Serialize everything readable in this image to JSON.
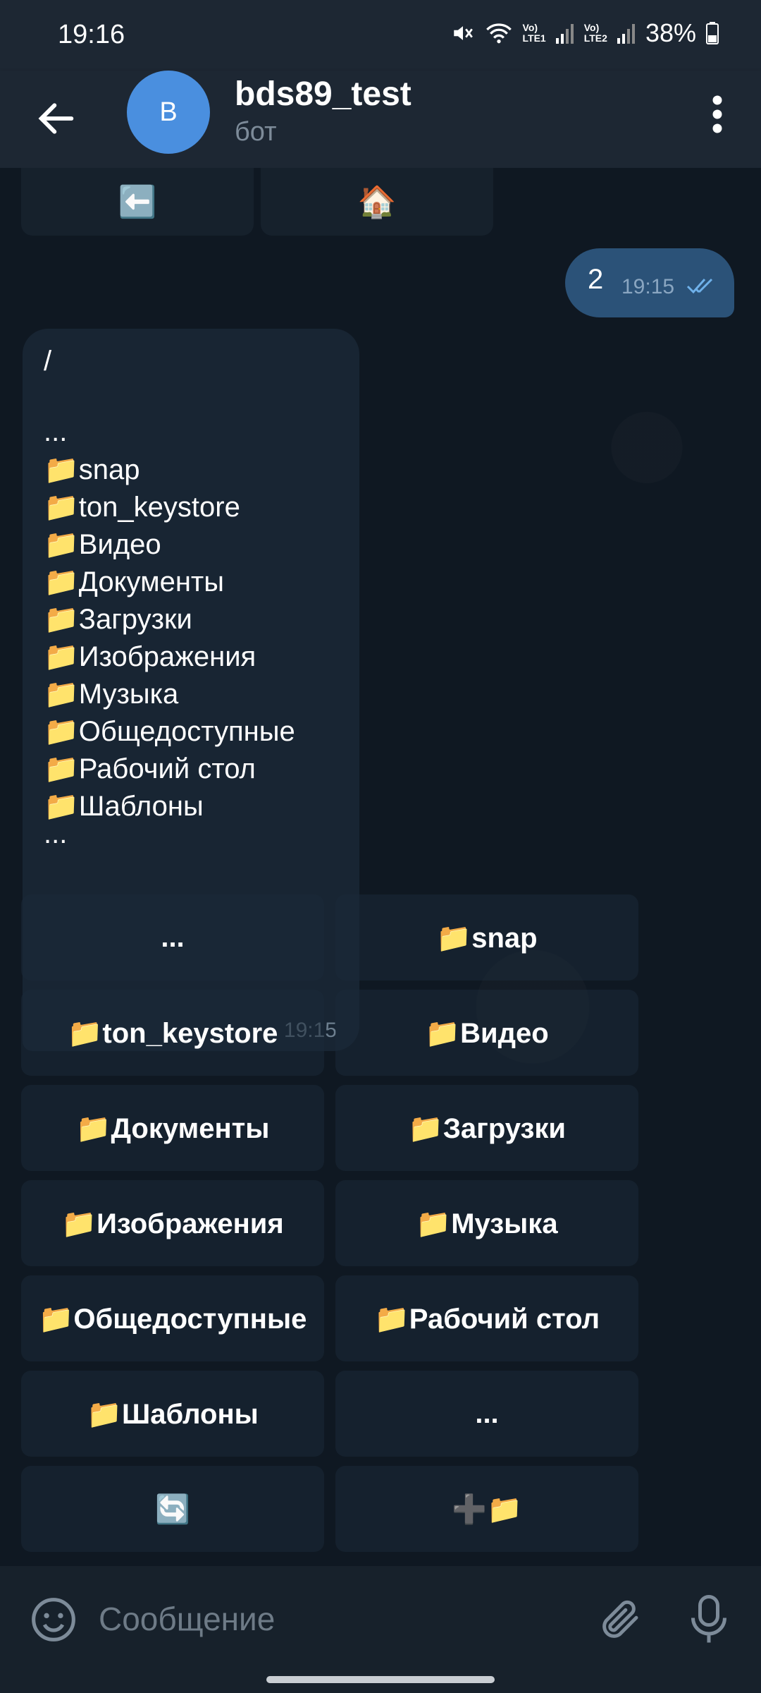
{
  "status_bar": {
    "time": "19:16",
    "sim1": [
      "Vo)",
      "LTE1"
    ],
    "sim2": [
      "Vo)",
      "LTE2"
    ],
    "battery": "38%"
  },
  "header": {
    "avatar_letter": "B",
    "title": "bds89_test",
    "subtitle": "бот"
  },
  "top_keyboard": [
    "⬅️",
    "🏠"
  ],
  "outgoing": {
    "text": "2",
    "time": "19:15"
  },
  "incoming": {
    "lines": [
      "/",
      "",
      "...",
      "📁snap",
      "📁ton_keystore",
      "📁Видео",
      "📁Документы",
      "📁Загрузки",
      "📁Изображения",
      "📁Музыка",
      "📁Общедоступные",
      "📁Рабочий стол",
      "📁Шаблоны",
      "..."
    ],
    "time": "19:15"
  },
  "keyboard": [
    [
      "...",
      "📁snap"
    ],
    [
      "📁ton_keystore",
      "📁Видео"
    ],
    [
      "📁Документы",
      "📁Загрузки"
    ],
    [
      "📁Изображения",
      "📁Музыка"
    ],
    [
      "📁Общедоступные",
      "📁Рабочий стол"
    ],
    [
      "📁Шаблоны",
      "..."
    ],
    [
      "🔄",
      "➕📁"
    ]
  ],
  "composer": {
    "placeholder": "Сообщение"
  },
  "colors": {
    "accent": "#4a8fdf",
    "bubble_out": "#2b5278",
    "bubble_in": "#182533"
  }
}
